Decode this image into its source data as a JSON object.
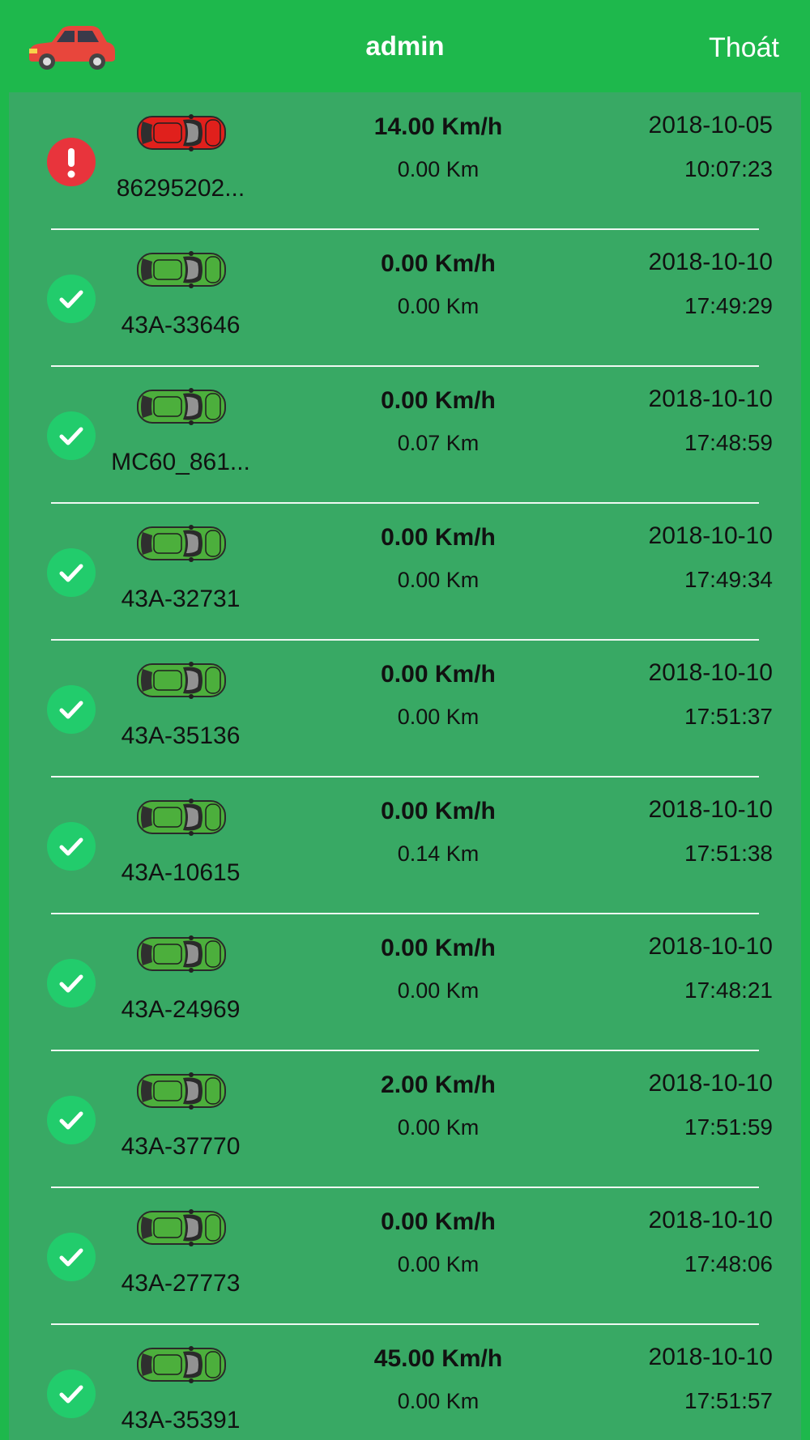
{
  "header": {
    "title": "admin",
    "logout_label": "Thoát",
    "logo_icon": "red-car-icon"
  },
  "colors": {
    "header_bg": "#1eb84c",
    "list_bg": "#38a964",
    "status_ok": "#22cc6c",
    "status_alert": "#e8343c",
    "car_alert": "#e0201c",
    "car_ok": "#4caf3c"
  },
  "vehicles": [
    {
      "plate": "86295202...",
      "speed": "14.00 Km/h",
      "distance": "0.00 Km",
      "date": "2018-10-05",
      "time": "10:07:23",
      "status": "alert",
      "status_icon": "exclamation-icon"
    },
    {
      "plate": "43A-33646",
      "speed": "0.00 Km/h",
      "distance": "0.00 Km",
      "date": "2018-10-10",
      "time": "17:49:29",
      "status": "ok",
      "status_icon": "check-icon"
    },
    {
      "plate": "MC60_861...",
      "speed": "0.00 Km/h",
      "distance": "0.07 Km",
      "date": "2018-10-10",
      "time": "17:48:59",
      "status": "ok",
      "status_icon": "check-icon"
    },
    {
      "plate": "43A-32731",
      "speed": "0.00 Km/h",
      "distance": "0.00 Km",
      "date": "2018-10-10",
      "time": "17:49:34",
      "status": "ok",
      "status_icon": "check-icon"
    },
    {
      "plate": "43A-35136",
      "speed": "0.00 Km/h",
      "distance": "0.00 Km",
      "date": "2018-10-10",
      "time": "17:51:37",
      "status": "ok",
      "status_icon": "check-icon"
    },
    {
      "plate": "43A-10615",
      "speed": "0.00 Km/h",
      "distance": "0.14 Km",
      "date": "2018-10-10",
      "time": "17:51:38",
      "status": "ok",
      "status_icon": "check-icon"
    },
    {
      "plate": "43A-24969",
      "speed": "0.00 Km/h",
      "distance": "0.00 Km",
      "date": "2018-10-10",
      "time": "17:48:21",
      "status": "ok",
      "status_icon": "check-icon"
    },
    {
      "plate": "43A-37770",
      "speed": "2.00 Km/h",
      "distance": "0.00 Km",
      "date": "2018-10-10",
      "time": "17:51:59",
      "status": "ok",
      "status_icon": "check-icon"
    },
    {
      "plate": "43A-27773",
      "speed": "0.00 Km/h",
      "distance": "0.00 Km",
      "date": "2018-10-10",
      "time": "17:48:06",
      "status": "ok",
      "status_icon": "check-icon"
    },
    {
      "plate": "43A-35391",
      "speed": "45.00 Km/h",
      "distance": "0.00 Km",
      "date": "2018-10-10",
      "time": "17:51:57",
      "status": "ok",
      "status_icon": "check-icon"
    }
  ]
}
